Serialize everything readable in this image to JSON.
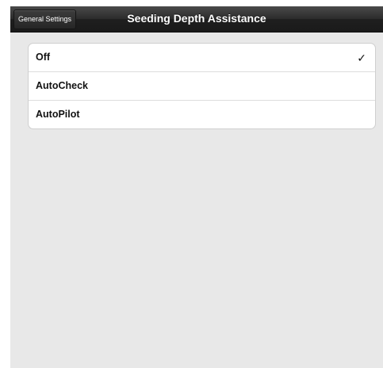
{
  "navbar": {
    "back_label": "General Settings",
    "title": "Seeding Depth Assistance"
  },
  "options": [
    {
      "label": "Off",
      "selected": true,
      "check_icon": "checkmark-icon",
      "check_glyph": "✓"
    },
    {
      "label": "AutoCheck",
      "selected": false
    },
    {
      "label": "AutoPilot",
      "selected": false
    }
  ]
}
